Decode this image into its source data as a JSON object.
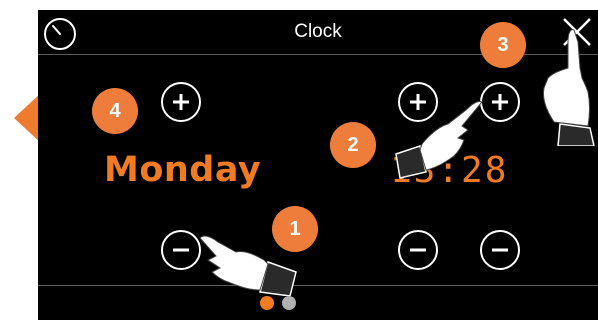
{
  "title": "Clock",
  "day": "Monday",
  "time": "13:28",
  "icons": {
    "clock": "clock-icon",
    "close": "close-icon",
    "plus": "plus-icon",
    "minus": "minus-icon",
    "back_arrow": "arrow-left-icon",
    "pointer": "pointing-hand-icon"
  },
  "callouts": [
    "1",
    "2",
    "3",
    "4"
  ],
  "pagination": {
    "total": 2,
    "active": 1
  },
  "colors": {
    "accent": "#f07b23",
    "background": "#000000",
    "callout": "#ee7d3b"
  }
}
